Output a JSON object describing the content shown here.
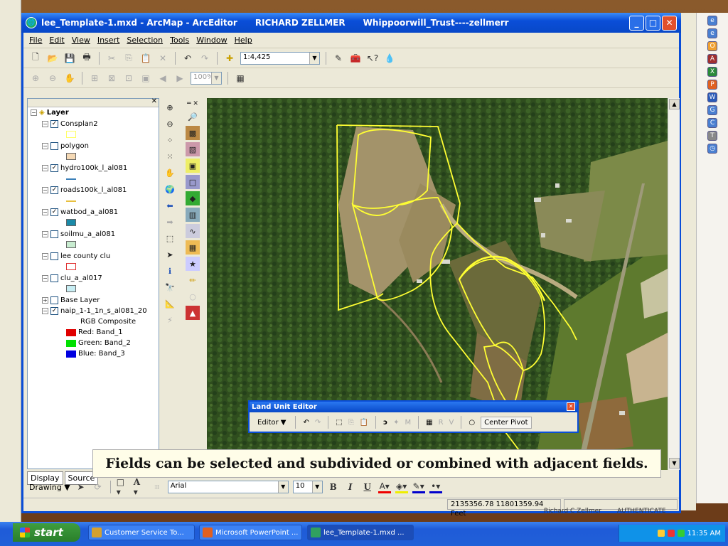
{
  "window": {
    "title": "lee_Template-1.mxd - ArcMap - ArcEditor      RICHARD ZELLMER      Whippoorwill_Trust----zellmerr",
    "min": "_",
    "max": "□",
    "close": "✕"
  },
  "menu": [
    "File",
    "Edit",
    "View",
    "Insert",
    "Selection",
    "Tools",
    "Window",
    "Help"
  ],
  "toolbar": {
    "scale": "1:4,425",
    "zoom": "100%"
  },
  "toc": {
    "root": "Layer",
    "layers": [
      {
        "name": "Consplan2",
        "checked": "✓",
        "exp": "−",
        "swatch": "#ffff66",
        "swatch_type": "outline"
      },
      {
        "name": "polygon",
        "checked": "",
        "exp": "−",
        "swatch": "#f5d9b5",
        "swatch_type": "fill"
      },
      {
        "name": "hydro100k_l_al081",
        "checked": "✓",
        "exp": "−",
        "swatch": "#3a7fb8",
        "swatch_type": "line"
      },
      {
        "name": "roads100k_l_al081",
        "checked": "✓",
        "exp": "−",
        "swatch": "#e8c040",
        "swatch_type": "line"
      },
      {
        "name": "watbod_a_al081",
        "checked": "✓",
        "exp": "−",
        "swatch": "#1a8aa8",
        "swatch_type": "fill"
      },
      {
        "name": "soilmu_a_al081",
        "checked": "",
        "exp": "−",
        "swatch": "#c8ecd0",
        "swatch_type": "fill"
      },
      {
        "name": "lee county clu",
        "checked": "",
        "exp": "−",
        "swatch": "#e03030",
        "swatch_type": "outline"
      },
      {
        "name": "clu_a_al017",
        "checked": "",
        "exp": "−",
        "swatch": "#c8eef4",
        "swatch_type": "fill"
      },
      {
        "name": "Base Layer",
        "checked": "",
        "exp": "+",
        "swatch": "",
        "swatch_type": "none"
      },
      {
        "name": "naip_1-1_1n_s_al081_20",
        "checked": "✓",
        "exp": "−",
        "swatch": "",
        "swatch_type": "none"
      }
    ],
    "rgb_label": "RGB Composite",
    "bands": [
      {
        "label": "Red:   Band_1",
        "color": "#e00000"
      },
      {
        "label": "Green: Band_2",
        "color": "#00e000"
      },
      {
        "label": "Blue:   Band_3",
        "color": "#0000e0"
      }
    ],
    "tabs": [
      "Display",
      "Source"
    ]
  },
  "land_unit_editor": {
    "title": "Land Unit Editor",
    "editor_label": "Editor ▼",
    "letters": [
      "M",
      "R",
      "V"
    ],
    "center_pivot": "Center Pivot"
  },
  "caption": "Fields can be selected and subdivided or combined with adjacent fields.",
  "drawing": {
    "label": "Drawing ▼",
    "font": "Arial",
    "size": "10",
    "bold": "B",
    "italic": "I",
    "underline": "U"
  },
  "status": {
    "coords": "2135356.78  11801359.94 Feet"
  },
  "background_text": {
    "left": "Richard C Zellmer",
    "right": "AUTHENTICATE"
  },
  "taskbar": {
    "start": "start",
    "tasks": [
      {
        "label": "Customer Service To...",
        "color": "#d4a030"
      },
      {
        "label": "Microsoft PowerPoint ...",
        "color": "#e06020"
      },
      {
        "label": "lee_Template-1.mxd ...",
        "color": "#30a060"
      }
    ],
    "clock": "11:35 AM"
  },
  "colors": {
    "titlebar": "#0a4ed8",
    "field_outline": "#ffff33",
    "selection_outline": "#00ffff"
  }
}
